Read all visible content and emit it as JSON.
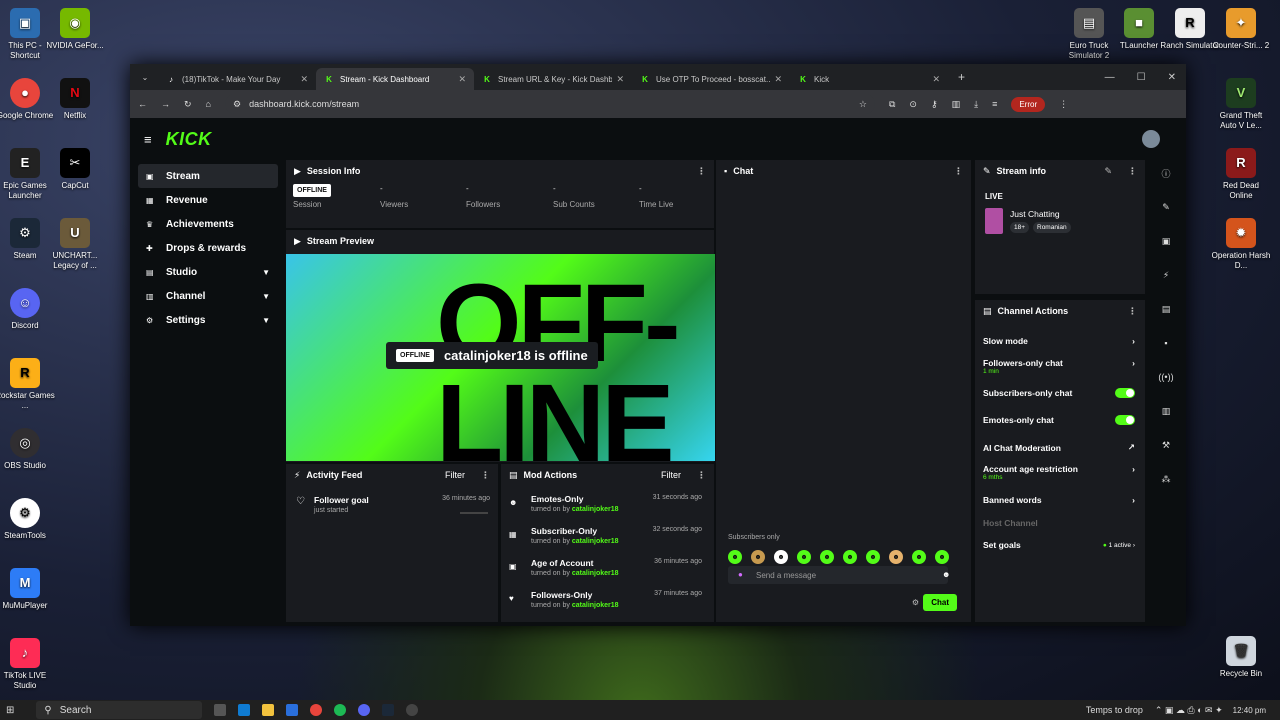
{
  "desktop": {
    "left": [
      "This PC - Shortcut",
      "NVIDIA GeFor...",
      "Google Chrome",
      "Netflix",
      "Epic Games Launcher",
      "CapCut",
      "Steam",
      "UNCHART... Legacy of ...",
      "Discord",
      "Rockstar Games ...",
      "OBS Studio",
      "SteamTools",
      "MuMuPlayer",
      "TikTok LIVE Studio"
    ],
    "right": [
      "Euro Truck Simulator 2",
      "TLauncher",
      "Ranch Simulator",
      "Counter-Stri... 2",
      "Grand Theft Auto V Le...",
      "Red Dead Online",
      "Operation Harsh D...",
      "Recycle Bin"
    ]
  },
  "browser": {
    "tabs": [
      "(18)TikTok - Make Your Day",
      "Stream - Kick Dashboard",
      "Stream URL & Key - Kick Dashb...",
      "Use OTP To Proceed - bosscat...",
      "Kick"
    ],
    "url": "dashboard.kick.com/stream",
    "error_label": "Error"
  },
  "kick": {
    "logo": "KICK"
  },
  "nav": [
    {
      "label": "Stream"
    },
    {
      "label": "Revenue"
    },
    {
      "label": "Achievements"
    },
    {
      "label": "Drops & rewards"
    },
    {
      "label": "Studio"
    },
    {
      "label": "Channel"
    },
    {
      "label": "Settings"
    }
  ],
  "session": {
    "title": "Session Info",
    "status": "OFFLINE",
    "stats": [
      {
        "label": "Session",
        "value": ""
      },
      {
        "label": "Viewers",
        "value": "-"
      },
      {
        "label": "Followers",
        "value": "-"
      },
      {
        "label": "Sub Counts",
        "value": "-"
      },
      {
        "label": "Time Live",
        "value": "-"
      }
    ]
  },
  "preview": {
    "title": "Stream Preview",
    "graphic_text": "OFF- LINE",
    "badge": "OFFLINE",
    "message": "catalinjoker18 is offline"
  },
  "activity": {
    "title": "Activity Feed",
    "filter": "Filter",
    "items": [
      {
        "title": "Follower goal",
        "sub": "just started",
        "time": "36 minutes ago"
      }
    ]
  },
  "mod": {
    "title": "Mod Actions",
    "filter": "Filter",
    "by_prefix": "turned on by",
    "items": [
      {
        "title": "Emotes-Only",
        "user": "catalinjoker18",
        "time": "31 seconds ago"
      },
      {
        "title": "Subscriber-Only",
        "user": "catalinjoker18",
        "time": "32 seconds ago"
      },
      {
        "title": "Age of Account",
        "user": "catalinjoker18",
        "time": "36 minutes ago"
      },
      {
        "title": "Followers-Only",
        "user": "catalinjoker18",
        "time": "37 minutes ago"
      }
    ]
  },
  "chat": {
    "title": "Chat",
    "mode": "Subscribers only",
    "placeholder": "Send a message",
    "send_label": "Chat"
  },
  "stream_info": {
    "title": "Stream info",
    "live_label": "LIVE",
    "category": "Just Chatting",
    "tags": [
      "18+",
      "Romanian"
    ]
  },
  "channel_actions": {
    "title": "Channel Actions",
    "items": [
      {
        "label": "Slow mode"
      },
      {
        "label": "Followers-only chat",
        "sub": "1 min"
      },
      {
        "label": "Subscribers-only chat",
        "enabled": true
      },
      {
        "label": "Emotes-only chat",
        "enabled": true
      },
      {
        "label": "AI Chat Moderation"
      },
      {
        "label": "Account age restriction",
        "sub": "6 mths"
      },
      {
        "label": "Banned words"
      },
      {
        "label": "Host Channel"
      },
      {
        "label": "Set goals",
        "sub": "1 active"
      }
    ]
  },
  "taskbar": {
    "search_label": "Search",
    "weather": "Temps to drop",
    "time": "12:40 pm"
  },
  "colors": {
    "accent": "#53fc18",
    "panel": "#191b1f",
    "background": "#0b0e10"
  }
}
